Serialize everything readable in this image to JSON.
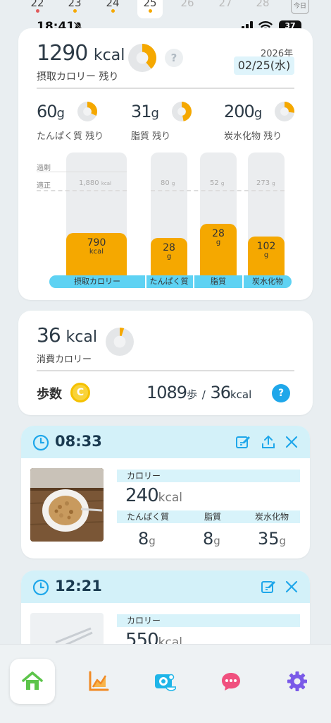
{
  "date_strip": {
    "days": [
      {
        "label": "22",
        "dot": "#e05a5a",
        "faded": false,
        "selected": false
      },
      {
        "label": "23",
        "dot": "#f5a800",
        "faded": false,
        "selected": false
      },
      {
        "label": "24",
        "dot": "#f5a800",
        "faded": false,
        "selected": false
      },
      {
        "label": "25",
        "dot": "#f5a800",
        "faded": false,
        "selected": true
      },
      {
        "label": "26",
        "dot": "",
        "faded": true,
        "selected": false
      },
      {
        "label": "27",
        "dot": "",
        "faded": true,
        "selected": false
      },
      {
        "label": "28",
        "dot": "",
        "faded": true,
        "selected": false
      }
    ],
    "today_label": "今日"
  },
  "status_bar": {
    "time": "18:41",
    "battery": "37"
  },
  "summary": {
    "calories_remaining": "1290",
    "calories_unit": "kcal",
    "calories_label": "摂取カロリー 残り",
    "year": "2026年",
    "date": "02/25(水)",
    "help": "?",
    "macros": [
      {
        "value": "60",
        "unit": "g",
        "label": "たんぱく質 残り",
        "consumed_fraction": 0.32
      },
      {
        "value": "31",
        "unit": "g",
        "label": "脂質 残り",
        "consumed_fraction": 0.47
      },
      {
        "value": "200",
        "unit": "g",
        "label": "炭水化物 残り",
        "consumed_fraction": 0.27
      }
    ],
    "calorie_consumed_fraction": 0.39
  },
  "chart_data": {
    "type": "bar",
    "categories": [
      "摂取カロリー",
      "たんぱく質",
      "脂質",
      "炭水化物"
    ],
    "values": [
      790,
      28,
      28,
      102
    ],
    "units": [
      "kcal",
      "g",
      "g",
      "g"
    ],
    "targets": [
      "1,880",
      "80",
      "52",
      "273"
    ],
    "target_units": [
      "kcal",
      "g",
      "g",
      "g"
    ],
    "fill_fractions": [
      0.42,
      0.35,
      0.54,
      0.37
    ],
    "level_labels": {
      "over": "過剰",
      "proper": "適正"
    }
  },
  "burned": {
    "value": "36",
    "unit": "kcal",
    "label": "消費カロリー",
    "fraction": 0.05,
    "steps_label": "歩数",
    "coin": "C",
    "steps_value": "1089",
    "steps_unit": "歩",
    "separator": "/",
    "steps_kcal": "36",
    "steps_kcal_unit": "kcal",
    "help": "?"
  },
  "meals": [
    {
      "time": "08:33",
      "calorie_label": "カロリー",
      "calories": "240",
      "calories_unit": "kcal",
      "cols": [
        {
          "label": "たんぱく質",
          "value": "8",
          "unit": "g"
        },
        {
          "label": "脂質",
          "value": "8",
          "unit": "g"
        },
        {
          "label": "炭水化物",
          "value": "35",
          "unit": "g"
        }
      ]
    },
    {
      "time": "12:21",
      "calorie_label": "カロリー",
      "calories": "550",
      "calories_unit": "kcal"
    }
  ],
  "tabs": [
    {
      "name": "home",
      "color": "#5cc44a"
    },
    {
      "name": "graph",
      "color": "#f08a24"
    },
    {
      "name": "camera",
      "color": "#1fb5e8"
    },
    {
      "name": "chat",
      "color": "#f0507e"
    },
    {
      "name": "settings",
      "color": "#7a5ae8"
    }
  ]
}
